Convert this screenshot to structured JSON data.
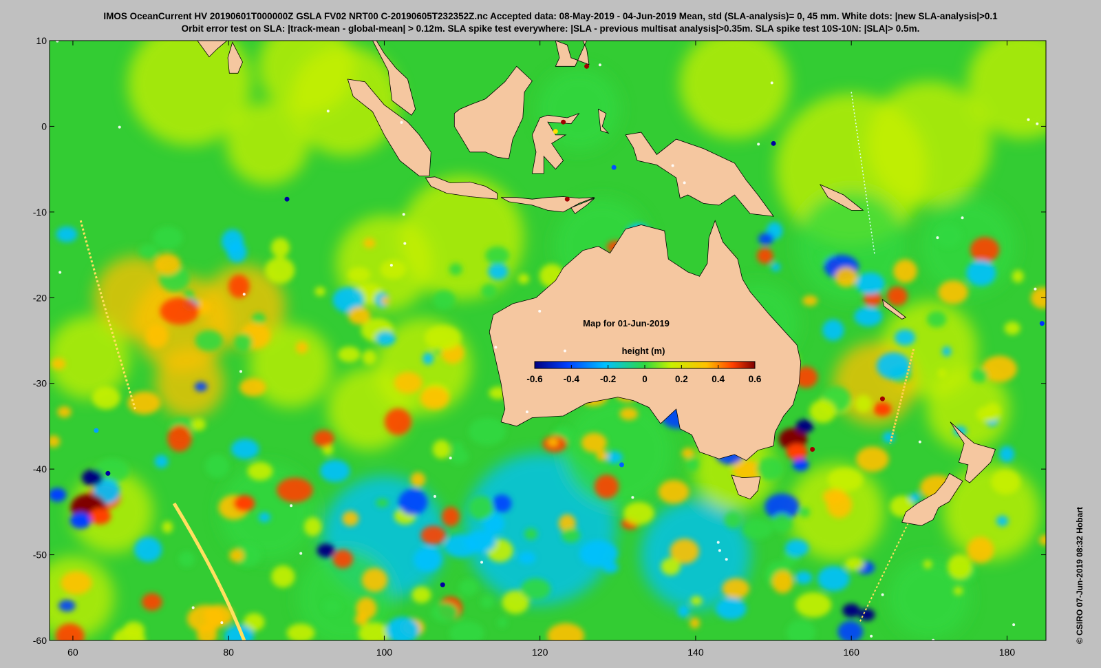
{
  "header": {
    "line1": "IMOS OceanCurrent HV 20190601T000000Z GSLA FV02 NRT00 C-20190605T232352Z.nc  Accepted data: 08-May-2019 - 04-Jun-2019 Mean, std (SLA-analysis)= 0, 45 mm. White dots: |new SLA-analysis|>0.1",
    "line2": "Orbit error test on SLA: |track-mean  - global-mean| > 0.12m.  SLA spike test everywhere: |SLA - previous multisat analysis|>0.35m. SLA spike test 10S-10N: |SLA|> 0.5m."
  },
  "map": {
    "caption": "Map for 01-Jun-2019",
    "colorbar_title": "height (m)",
    "colorbar_ticks": [
      "-0.6",
      "-0.4",
      "-0.2",
      "0",
      "0.2",
      "0.4",
      "0.6"
    ],
    "x_ticks": [
      "60",
      "80",
      "100",
      "120",
      "140",
      "160",
      "180"
    ],
    "y_ticks": [
      "10",
      "0",
      "-10",
      "-20",
      "-30",
      "-40",
      "-50",
      "-60"
    ],
    "x_range": [
      57,
      185
    ],
    "y_range": [
      -60,
      10
    ],
    "colors": {
      "ocean_base": "#33cc33",
      "land": "#f5c7a0",
      "colormap": [
        "#00007f",
        "#0040ff",
        "#00c0ff",
        "#30d840",
        "#c8f000",
        "#ffc000",
        "#ff4000",
        "#7f0000"
      ]
    },
    "credit": "© CSIRO 07-Jun-2019 08:32 Hobart"
  }
}
